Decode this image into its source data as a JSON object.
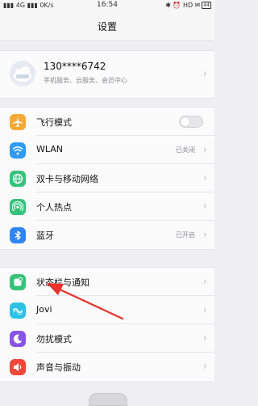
{
  "status_bar": {
    "left": "▮▮▮ 4G ▮▮▮ 0K/s",
    "time": "16:54",
    "right": "✱ ⏰ HD ✉",
    "battery": "44"
  },
  "header": {
    "title": "设置"
  },
  "account": {
    "phone": "130****6742",
    "subtitle": "手机服务、云服务、会员中心"
  },
  "group1": [
    {
      "label": "飞行模式",
      "icon": "airplane-icon",
      "color": "#f7a935",
      "toggle": false
    },
    {
      "label": "WLAN",
      "icon": "wifi-icon",
      "color": "#2f9bf2",
      "value": "已关闭"
    },
    {
      "label": "双卡与移动网络",
      "icon": "globe-icon",
      "color": "#36c27a"
    },
    {
      "label": "个人热点",
      "icon": "hotspot-icon",
      "color": "#36c27a"
    },
    {
      "label": "蓝牙",
      "icon": "bluetooth-icon",
      "color": "#2f86f2",
      "value": "已开启"
    }
  ],
  "group2": [
    {
      "label": "状态栏与通知",
      "icon": "status-bar-icon",
      "color": "#36c27a"
    },
    {
      "label": "Jovi",
      "icon": "jovi-icon",
      "color": "#2ec3e6"
    },
    {
      "label": "勿扰模式",
      "icon": "moon-icon",
      "color": "#8b54e8"
    },
    {
      "label": "声音与振动",
      "icon": "speaker-icon",
      "color": "#f0473b"
    }
  ],
  "chevron": "›"
}
